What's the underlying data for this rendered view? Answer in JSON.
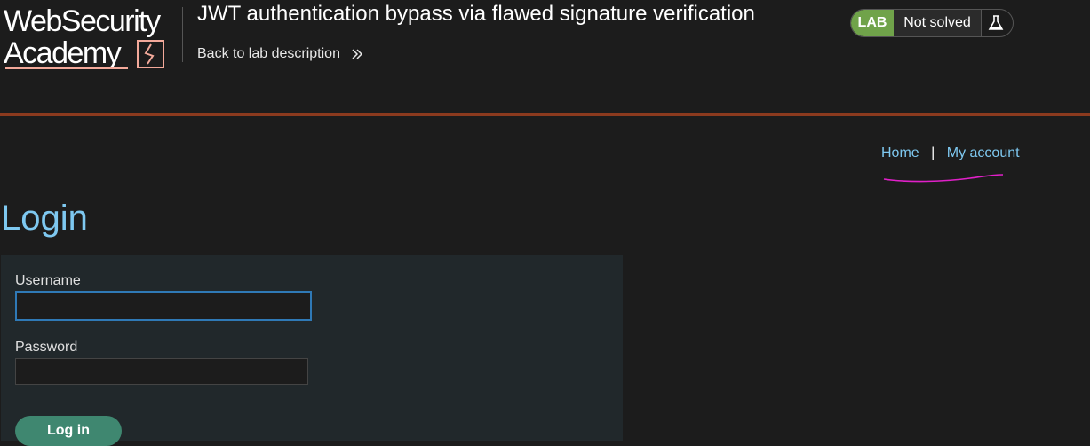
{
  "header": {
    "logo_line1": "WebSecurity",
    "logo_line2": "Academy",
    "lab_title": "JWT authentication bypass via flawed signature verification",
    "back_link": "Back to lab description"
  },
  "status": {
    "badge": "LAB",
    "text": "Not solved"
  },
  "nav": {
    "home": "Home",
    "separator": "|",
    "account": "My account"
  },
  "page": {
    "title": "Login"
  },
  "login_form": {
    "username_label": "Username",
    "username_value": "",
    "password_label": "Password",
    "password_value": "",
    "submit_label": "Log in"
  },
  "colors": {
    "background": "#1c1c1c",
    "accent_blue": "#7ec8f0",
    "lab_green": "#70a34a",
    "button_green": "#3f8770",
    "rule_orange": "#8b3a1e",
    "annotation_magenta": "#e020c8"
  },
  "icons": {
    "back": "double-chevron-right-icon",
    "status": "flask-icon"
  }
}
